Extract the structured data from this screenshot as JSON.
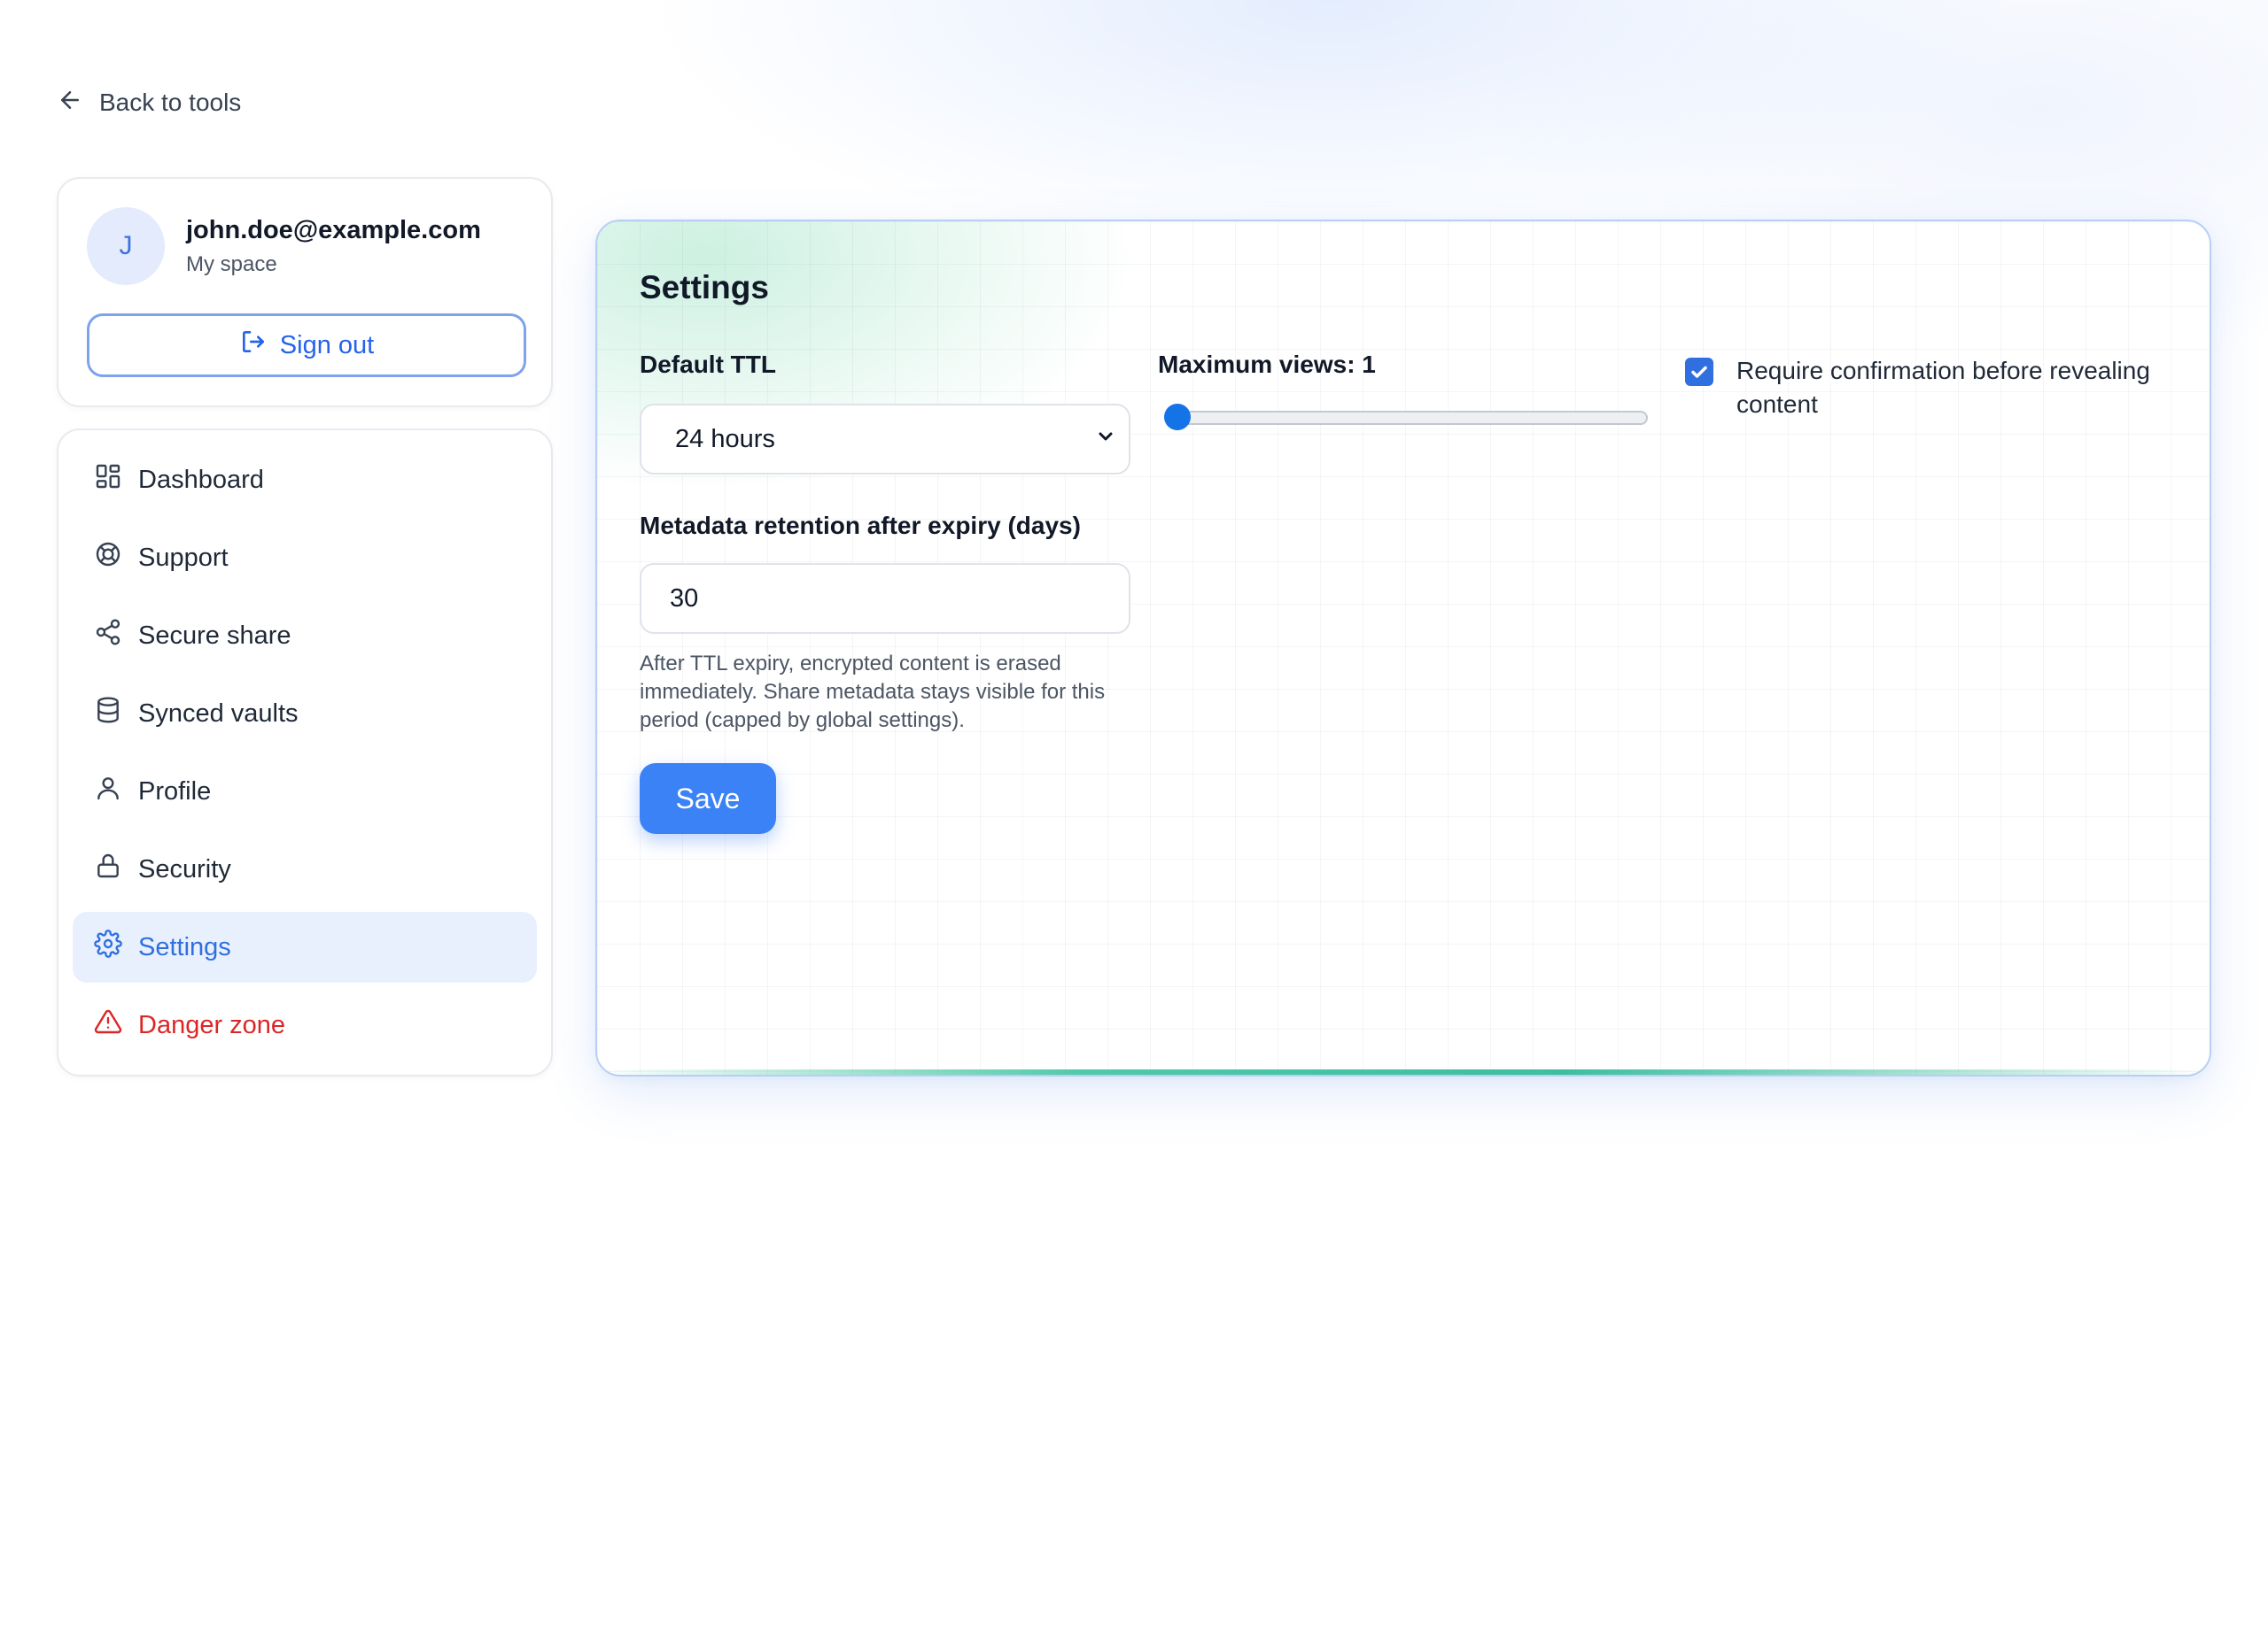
{
  "back_link": {
    "label": "Back to tools"
  },
  "user": {
    "initial": "J",
    "email": "john.doe@example.com",
    "space": "My space",
    "sign_out_label": "Sign out"
  },
  "sidebar": {
    "items": [
      {
        "label": "Dashboard",
        "icon": "dashboard-icon"
      },
      {
        "label": "Support",
        "icon": "lifebuoy-icon"
      },
      {
        "label": "Secure share",
        "icon": "share-icon"
      },
      {
        "label": "Synced vaults",
        "icon": "database-icon"
      },
      {
        "label": "Profile",
        "icon": "user-icon"
      },
      {
        "label": "Security",
        "icon": "lock-icon"
      },
      {
        "label": "Settings",
        "icon": "gear-icon",
        "active": true
      },
      {
        "label": "Danger zone",
        "icon": "warning-icon",
        "danger": true
      }
    ]
  },
  "settings": {
    "title": "Settings",
    "default_ttl": {
      "label": "Default TTL",
      "value": "24 hours"
    },
    "max_views": {
      "label": "Maximum views: 1",
      "value": 1,
      "fraction": 0
    },
    "confirm": {
      "label": "Require confirmation before revealing content",
      "checked": true
    },
    "retention": {
      "label": "Metadata retention after expiry (days)",
      "value": "30"
    },
    "help": "After TTL expiry, encrypted content is erased immediately. Share metadata stays visible for this period (capped by global settings).",
    "save_label": "Save"
  },
  "colors": {
    "accent": "#3b82f6",
    "active_bg": "#e9f0fd",
    "danger": "#dc2626",
    "panel_border": "#b8cff3",
    "progress_bar": "#3bbf9e"
  }
}
